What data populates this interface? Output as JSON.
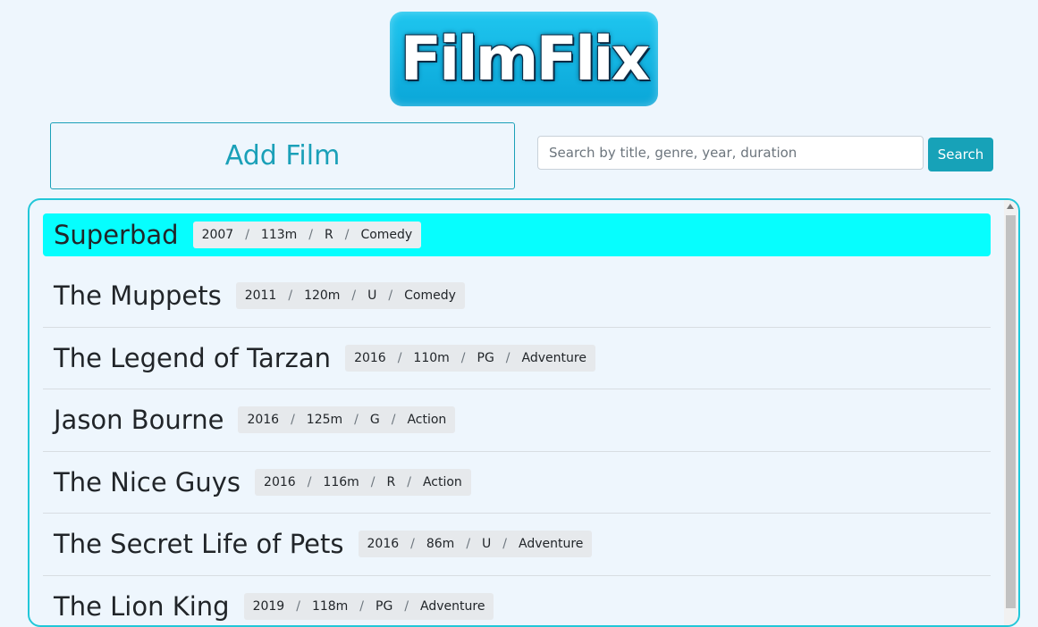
{
  "logo": {
    "text": "FilmFlix"
  },
  "toolbar": {
    "add_film_label": "Add Film",
    "search_placeholder": "Search by title, genre, year, duration",
    "search_value": "",
    "search_label": "Search"
  },
  "films": [
    {
      "title": "Superbad",
      "year": "2007",
      "duration": "113m",
      "rating": "R",
      "genre": "Comedy",
      "selected": true
    },
    {
      "title": "The Muppets",
      "year": "2011",
      "duration": "120m",
      "rating": "U",
      "genre": "Comedy"
    },
    {
      "title": "The Legend of Tarzan",
      "year": "2016",
      "duration": "110m",
      "rating": "PG",
      "genre": "Adventure"
    },
    {
      "title": "Jason Bourne",
      "year": "2016",
      "duration": "125m",
      "rating": "G",
      "genre": "Action"
    },
    {
      "title": "The Nice Guys",
      "year": "2016",
      "duration": "116m",
      "rating": "R",
      "genre": "Action"
    },
    {
      "title": "The Secret Life of Pets",
      "year": "2016",
      "duration": "86m",
      "rating": "U",
      "genre": "Adventure"
    },
    {
      "title": "The Lion King",
      "year": "2019",
      "duration": "118m",
      "rating": "PG",
      "genre": "Adventure"
    }
  ],
  "meta_separator": "/",
  "colors": {
    "accent": "#17a2b8",
    "selected_row": "#06fefe",
    "panel_border": "#22c7d8",
    "logo_bg": "#0ab4e4",
    "page_bg": "#eef6fd"
  }
}
